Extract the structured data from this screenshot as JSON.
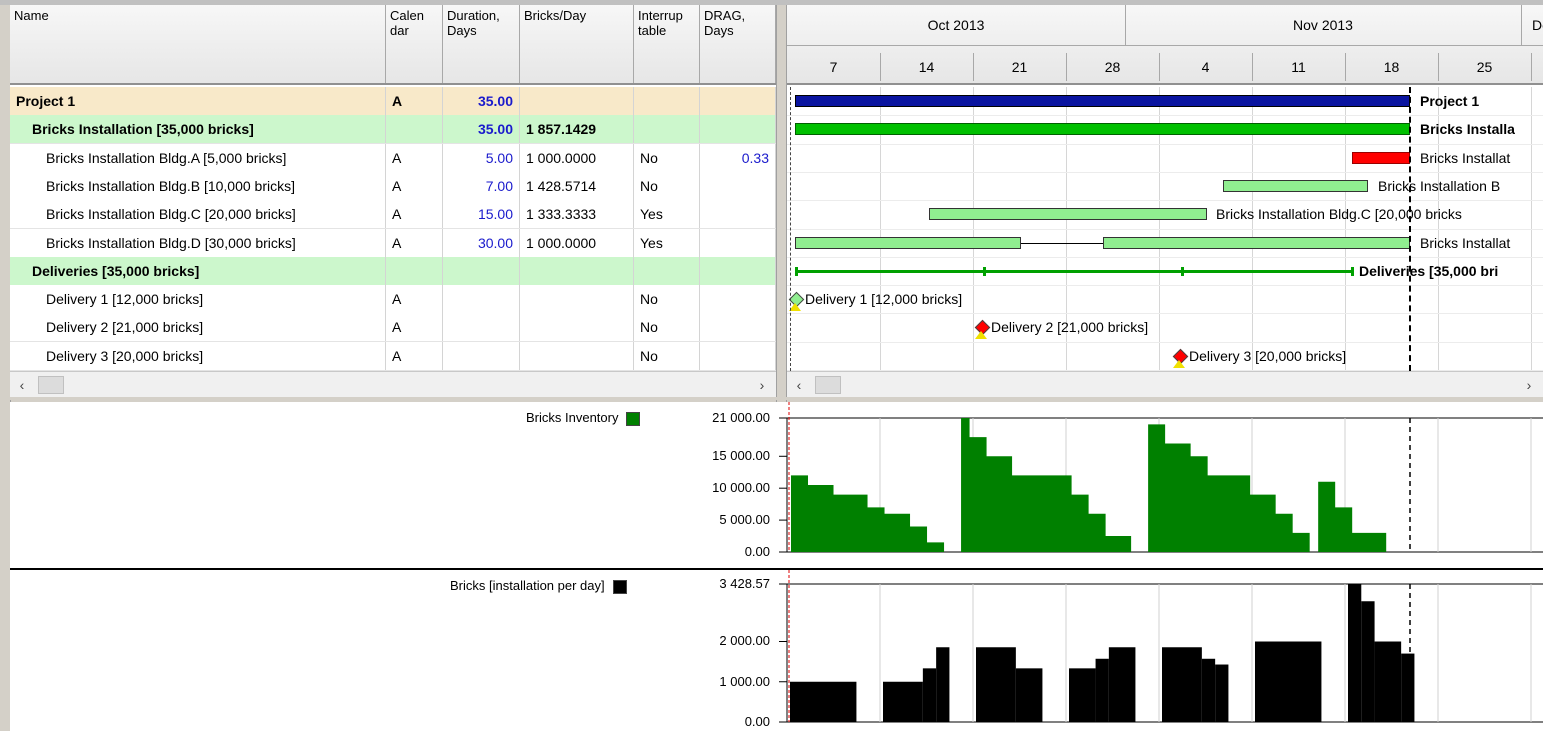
{
  "table": {
    "columns": [
      {
        "label": "Name"
      },
      {
        "label": "Calen dar"
      },
      {
        "label": "Duration, Days"
      },
      {
        "label": "Bricks/Day"
      },
      {
        "label": "Interrup table"
      },
      {
        "label": "DRAG, Days"
      }
    ],
    "rows": [
      {
        "name": "Project 1",
        "calendar": "A",
        "duration": "35.00",
        "bricks_day": "",
        "interruptable": "",
        "drag": ""
      },
      {
        "name": "Bricks Installation [35,000 bricks]",
        "calendar": "",
        "duration": "35.00",
        "bricks_day": "1 857.1429",
        "interruptable": "",
        "drag": ""
      },
      {
        "name": "Bricks Installation  Bldg.A [5,000 bricks]",
        "calendar": "A",
        "duration": "5.00",
        "bricks_day": "1 000.0000",
        "interruptable": "No",
        "drag": "0.33"
      },
      {
        "name": "Bricks Installation Bldg.B [10,000 bricks]",
        "calendar": "A",
        "duration": "7.00",
        "bricks_day": "1 428.5714",
        "interruptable": "No",
        "drag": ""
      },
      {
        "name": "Bricks Installation Bldg.C [20,000 bricks]",
        "calendar": "A",
        "duration": "15.00",
        "bricks_day": "1 333.3333",
        "interruptable": "Yes",
        "drag": ""
      },
      {
        "name": "Bricks Installation Bldg.D [30,000 bricks]",
        "calendar": "A",
        "duration": "30.00",
        "bricks_day": "1 000.0000",
        "interruptable": "Yes",
        "drag": ""
      },
      {
        "name": "Deliveries [35,000 bricks]",
        "calendar": "",
        "duration": "",
        "bricks_day": "",
        "interruptable": "",
        "drag": ""
      },
      {
        "name": "Delivery 1 [12,000 bricks]",
        "calendar": "A",
        "duration": "",
        "bricks_day": "",
        "interruptable": "No",
        "drag": ""
      },
      {
        "name": "Delivery 2 [21,000 bricks]",
        "calendar": "A",
        "duration": "",
        "bricks_day": "",
        "interruptable": "No",
        "drag": ""
      },
      {
        "name": "Delivery 3 [20,000 bricks]",
        "calendar": "A",
        "duration": "",
        "bricks_day": "",
        "interruptable": "No",
        "drag": ""
      }
    ]
  },
  "timeline": {
    "months": [
      "Oct 2013",
      "Nov 2013",
      "De"
    ],
    "weeks": [
      "7",
      "14",
      "21",
      "28",
      "4",
      "11",
      "18",
      "25"
    ]
  },
  "gantt": {
    "labels": {
      "project": "Project 1",
      "bricks": "Bricks Installa",
      "bldg_a": "Bricks Installat",
      "bldg_b": "Bricks Installation B",
      "bldg_c": "Bricks Installation Bldg.C [20,000 bricks",
      "bldg_d": "Bricks Installat",
      "deliveries": "Deliveries [35,000 bri",
      "delivery1": "Delivery 1 [12,000 bricks]",
      "delivery2": "Delivery 2 [21,000 bricks]",
      "delivery3": "Delivery 3 [20,000 bricks]"
    },
    "colors": {
      "summary": "#0a14a0",
      "group": "#00c000",
      "critical": "#ff0000",
      "task": "#90ee90",
      "milestone_done": "#90ee90",
      "milestone": "#ff0000"
    }
  },
  "charts": {
    "inventory": {
      "legend": "Bricks Inventory",
      "color": "#008000",
      "ticks": [
        "21 000.00",
        "15 000.00",
        "10 000.00",
        "5 000.00",
        "0.00"
      ]
    },
    "installation": {
      "legend": "Bricks [installation per day]",
      "color": "#000000",
      "ticks": [
        "3 428.57",
        "2 000.00",
        "1 000.00",
        "0.00"
      ]
    }
  },
  "chart_data": [
    {
      "type": "area",
      "title": "",
      "series": [
        {
          "name": "Bricks Inventory",
          "x": [
            0,
            2,
            5,
            9,
            11,
            14,
            16,
            18,
            20,
            21,
            23,
            26,
            30,
            33,
            35,
            37,
            40,
            42,
            44,
            47,
            49,
            54,
            57,
            59,
            61,
            62,
            64,
            66,
            70
          ],
          "y": [
            12000,
            10500,
            9000,
            7000,
            6000,
            4000,
            1500,
            0,
            21000,
            18000,
            15000,
            12000,
            12000,
            9000,
            6000,
            2500,
            0,
            20000,
            17000,
            15000,
            12000,
            9000,
            6000,
            3000,
            0,
            11000,
            7000,
            3000,
            0
          ]
        }
      ],
      "ylim": [
        0,
        21000
      ]
    },
    {
      "type": "bar",
      "title": "",
      "series": [
        {
          "name": "Bricks [installation per day]",
          "x": [
            0,
            10,
            20,
            30,
            40,
            50,
            60,
            64
          ],
          "y": [
            1000,
            1000,
            2428.57,
            1333.33,
            2428.57,
            2428.57,
            3428.57,
            2000
          ]
        }
      ],
      "ylim": [
        0,
        3428.57
      ]
    }
  ]
}
